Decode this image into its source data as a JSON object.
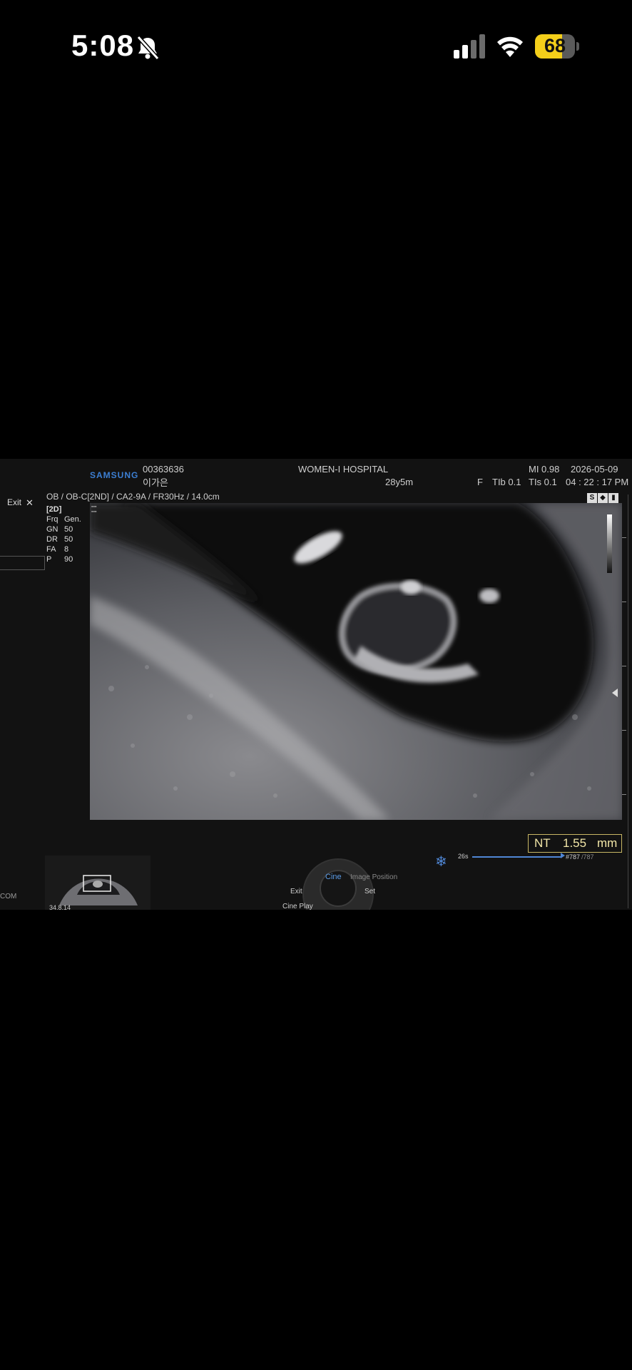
{
  "status_bar": {
    "time": "5:08",
    "battery": "68",
    "battery_level_percent": 68,
    "icons": [
      "bell-slash-icon",
      "cellular-signal-icon",
      "wifi-icon",
      "battery-icon"
    ]
  },
  "ultrasound": {
    "brand": "SAMSUNG",
    "patient_id": "00363636",
    "patient_name": "이가은",
    "hospital": "WOMEN-I HOSPITAL",
    "age": "28y5m",
    "sex": "F",
    "mi": "MI  0.98",
    "tib": "TIb 0.1",
    "tis": "TIs 0.1",
    "date": "2026-05-09",
    "time": "04 : 22 : 17 PM",
    "preset": "OB / OB-C[2ND] / CA2-9A / FR30Hz / 14.0cm",
    "mode": "[2D]",
    "exit_label": "Exit",
    "com_label": "COM",
    "params": [
      {
        "key": "Frq",
        "value": "Gen."
      },
      {
        "key": "GN",
        "value": "50"
      },
      {
        "key": "DR",
        "value": "50"
      },
      {
        "key": "FA",
        "value": "8"
      },
      {
        "key": "P",
        "value": "90"
      }
    ],
    "measurement": {
      "label": "NT",
      "value": "1.55",
      "unit": "mm"
    },
    "cine": {
      "duration": "26s",
      "frame_current": "#787",
      "frame_total": "/787",
      "progress_percent": 100
    },
    "controls": {
      "cine": "Cine",
      "image_position": "Image Position",
      "exit": "Exit",
      "set": "Set",
      "cine_play": "Cine Play"
    },
    "thumbnail_label": "34.8.14",
    "colors": {
      "accent_blue": "#3c7fd3",
      "measurement_yellow": "#f3e7a8",
      "panel_bg": "#121212"
    }
  }
}
